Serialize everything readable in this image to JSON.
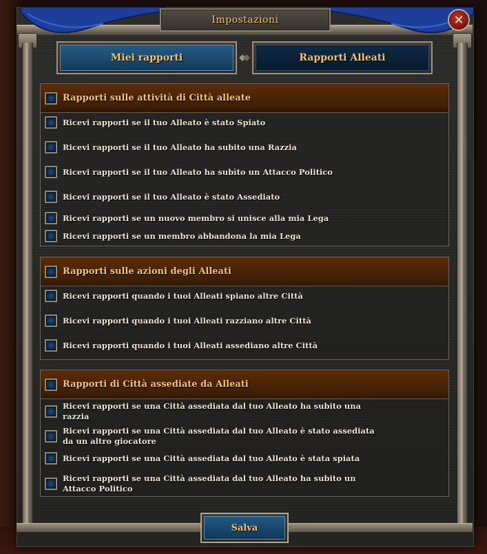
{
  "dialog": {
    "title": "Impostazioni",
    "close_glyph": "✕"
  },
  "tabs": [
    {
      "label": "Miei rapporti"
    },
    {
      "label": "Rapporti Alleati"
    }
  ],
  "sections": [
    {
      "header": "Rapporti sulle attività di Città alleate",
      "items": [
        "Ricevi rapporti se il tuo Alleato è stato Spiato",
        "Ricevi rapporti se il tuo Alleato ha subito una Razzia",
        "Ricevi rapporti se il tuo Alleato ha subìto un Attacco Politico",
        "Ricevi rapporti se il tuo Alleato è stato Assediato",
        "Ricevi rapporti se un nuovo membro si unisce alla mia Lega",
        "Ricevi rapporti se un membro abbandona la mia Lega"
      ]
    },
    {
      "header": "Rapporti sulle azioni degli Alleati",
      "items": [
        "Ricevi rapporti quando i tuoi Alleati spiano altre Città",
        "Ricevi rapporti quando i tuoi Alleati razziano altre Città",
        "Ricevi rapporti quando i tuoi Alleati assediano altre Città"
      ]
    },
    {
      "header": "Rapporti di Città assediate da Alleati",
      "items": [
        "Ricevi rapporti se una Città assediata dal tuo Alleato ha subito una razzia",
        "Ricevi rapporti se una Città assediata dal tuo Alleato è stato assediata da un altro giocatore",
        "Ricevi rapporti se una Città assediata dal tuo Alleato è stata spiata",
        "Ricevi rapporti se una Città assediata dal tuo Alleato ha subito un Attacco Politico"
      ]
    }
  ],
  "footer": {
    "save_label": "Salva"
  },
  "colors": {
    "accent_gold": "#f4c36a",
    "tab_active_blue": "#245b84",
    "section_header_brown": "#5c2c08",
    "close_red": "#c23a2a"
  }
}
